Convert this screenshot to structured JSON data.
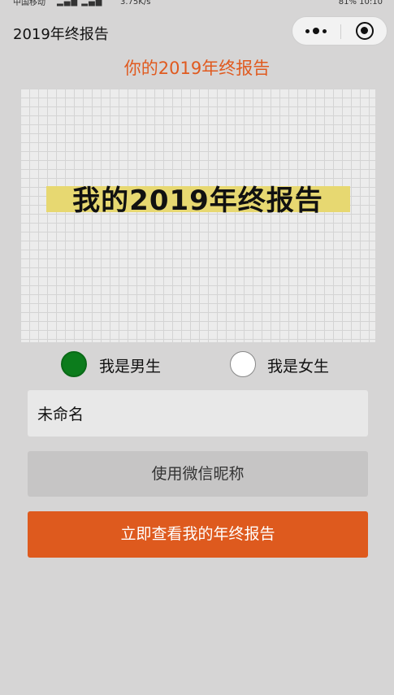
{
  "status_bar": {
    "carrier": "中国移动",
    "speed": "3.75K/s",
    "battery": "81%",
    "time": "10:10"
  },
  "titlebar": {
    "title": "2019年终报告",
    "more_icon": "more-dots-icon",
    "close_icon": "target-circle-icon"
  },
  "heading": "你的2019年终报告",
  "banner": {
    "text": "我的2019年终报告",
    "highlight_color": "#e7d871"
  },
  "gender": {
    "options": [
      {
        "label": "我是男生",
        "selected": true
      },
      {
        "label": "我是女生",
        "selected": false
      }
    ],
    "selected_color": "#0c7c1c"
  },
  "name_input": {
    "value": "未命名"
  },
  "buttons": {
    "use_wechat_nickname": "使用微信昵称",
    "view_report": "立即查看我的年终报告"
  },
  "colors": {
    "accent": "#de5a1e",
    "background": "#d6d5d5"
  }
}
